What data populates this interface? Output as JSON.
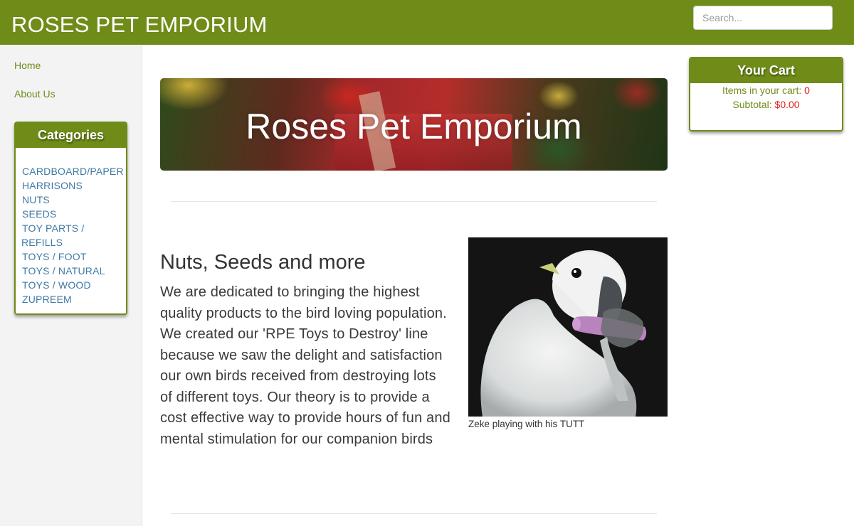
{
  "header": {
    "site_title": "ROSES PET EMPORIUM",
    "search_placeholder": "Search..."
  },
  "nav": {
    "home": "Home",
    "about": "About Us"
  },
  "categories": {
    "heading": "Categories",
    "items": [
      "CARDBOARD/PAPER",
      "HARRISONS",
      "NUTS",
      "SEEDS",
      "TOY PARTS /",
      "REFILLS",
      "TOYS / FOOT",
      "TOYS / NATURAL",
      "TOYS / WOOD",
      "ZUPREEM"
    ]
  },
  "banner": {
    "title": "Roses Pet Emporium"
  },
  "intro": {
    "title": "Nuts, Seeds and more",
    "body": "We are dedicated to bringing the highest quality products to the bird loving population. We created our 'RPE Toys to Destroy' line because we saw the delight and satisfaction our own birds received from destroying lots of different toys. Our theory is to provide a cost effective way to provide hours of fun and mental stimulation for our companion birds"
  },
  "photo": {
    "caption": "Zeke playing with his TUTT"
  },
  "cart": {
    "heading": "Your Cart",
    "items_label": "Items in your cart:",
    "items_count": "0",
    "subtotal_label": "Subtotal:",
    "subtotal_value": "$0.00"
  },
  "colors": {
    "brand_green": "#6f8c18",
    "link_blue": "#3f7aa5",
    "cart_value_red": "#e21b1b"
  }
}
